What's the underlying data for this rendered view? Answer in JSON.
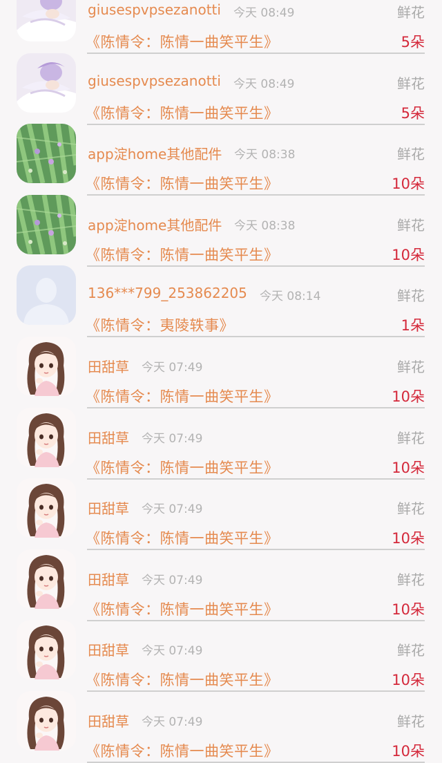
{
  "gift_rows": [
    {
      "avatar_icon": "anime-sleeping-avatar-icon",
      "name": "giusespvpsezanotti",
      "time": "今天 08:49",
      "gift": "鲜花",
      "title": "《陈情令：陈情一曲笑平生》",
      "count": "5朵"
    },
    {
      "avatar_icon": "anime-sleeping-avatar-icon",
      "name": "giusespvpsezanotti",
      "time": "今天 08:49",
      "gift": "鲜花",
      "title": "《陈情令：陈情一曲笑平生》",
      "count": "5朵"
    },
    {
      "avatar_icon": "cactus-avatar-icon",
      "name": "app淀home其他配件",
      "time": "今天 08:38",
      "gift": "鲜花",
      "title": "《陈情令：陈情一曲笑平生》",
      "count": "10朵"
    },
    {
      "avatar_icon": "cactus-avatar-icon",
      "name": "app淀home其他配件",
      "time": "今天 08:38",
      "gift": "鲜花",
      "title": "《陈情令：陈情一曲笑平生》",
      "count": "10朵"
    },
    {
      "avatar_icon": "default-user-avatar-icon",
      "name": "136***799_253862205",
      "time": "今天 08:14",
      "gift": "鲜花",
      "title": "《陈情令：夷陵轶事》",
      "count": "1朵"
    },
    {
      "avatar_icon": "girl-avatar-icon",
      "name": "田甜草",
      "time": "今天 07:49",
      "gift": "鲜花",
      "title": "《陈情令：陈情一曲笑平生》",
      "count": "10朵"
    },
    {
      "avatar_icon": "girl-avatar-icon",
      "name": "田甜草",
      "time": "今天 07:49",
      "gift": "鲜花",
      "title": "《陈情令：陈情一曲笑平生》",
      "count": "10朵"
    },
    {
      "avatar_icon": "girl-avatar-icon",
      "name": "田甜草",
      "time": "今天 07:49",
      "gift": "鲜花",
      "title": "《陈情令：陈情一曲笑平生》",
      "count": "10朵"
    },
    {
      "avatar_icon": "girl-avatar-icon",
      "name": "田甜草",
      "time": "今天 07:49",
      "gift": "鲜花",
      "title": "《陈情令：陈情一曲笑平生》",
      "count": "10朵"
    },
    {
      "avatar_icon": "girl-avatar-icon",
      "name": "田甜草",
      "time": "今天 07:49",
      "gift": "鲜花",
      "title": "《陈情令：陈情一曲笑平生》",
      "count": "10朵"
    },
    {
      "avatar_icon": "girl-avatar-icon",
      "name": "田甜草",
      "time": "今天 07:49",
      "gift": "鲜花",
      "title": "《陈情令：陈情一曲笑平生》",
      "count": "10朵"
    }
  ],
  "colors": {
    "name_text": "#e58a4f",
    "count_text": "#d4283a",
    "secondary_text": "#b3b3b3",
    "background": "#f8f6f7"
  }
}
